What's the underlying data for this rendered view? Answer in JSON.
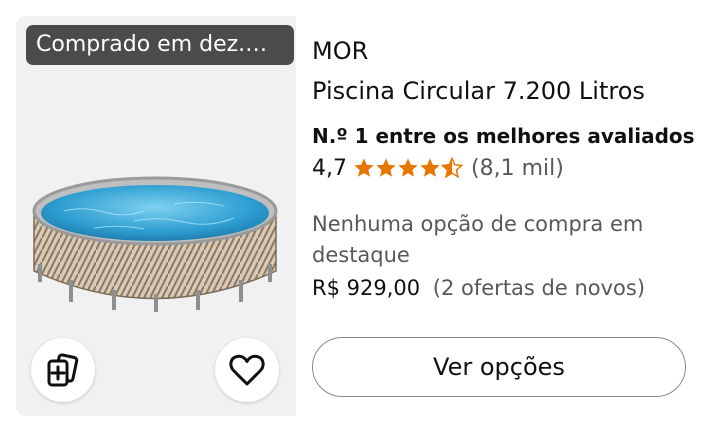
{
  "product": {
    "purchased_badge": "Comprado em dez.…",
    "brand": "MOR",
    "title": "Piscina Circular 7.200 Litros",
    "bestseller": "N.º 1 entre os melhores avaliados",
    "rating": {
      "value": "4,7",
      "count": "(8,1 mil)",
      "stars_filled": 4.7,
      "stars_max": 5,
      "star_color": "#e77600"
    },
    "no_offer_text": "Nenhuma opção de compra em destaque",
    "price": "R$ 929,00",
    "offers": "(2 ofertas de novos)",
    "cta_label": "Ver opções"
  },
  "icons": {
    "compare": "compare-cards-icon",
    "favorite": "heart-icon",
    "image": "pool-image"
  },
  "colors": {
    "badge_bg": "#4b4b4b",
    "image_bg": "#f1f1f1",
    "text": "#0f1111",
    "secondary_text": "#565959",
    "star": "#e77600"
  }
}
